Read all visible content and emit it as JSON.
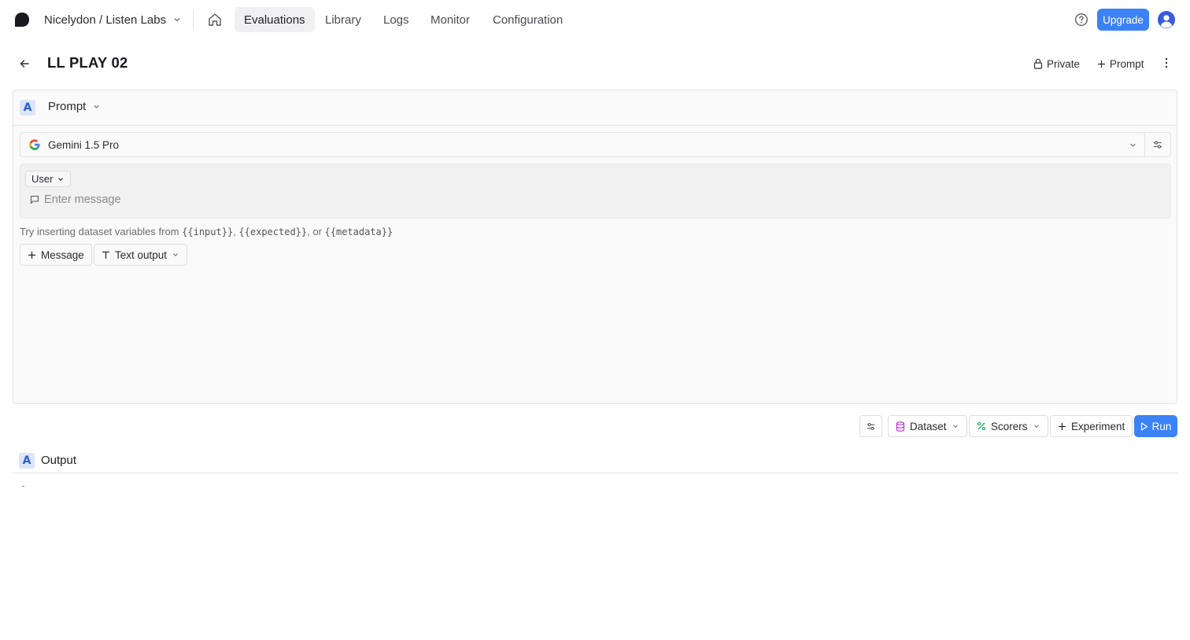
{
  "topbar": {
    "org": "Nicelydon / Listen Labs",
    "nav": [
      {
        "label": "Evaluations",
        "active": true
      },
      {
        "label": "Library",
        "active": false
      },
      {
        "label": "Logs",
        "active": false
      },
      {
        "label": "Monitor",
        "active": false
      },
      {
        "label": "Configuration",
        "active": false
      }
    ],
    "upgrade_label": "Upgrade",
    "accent": "#3b82f6"
  },
  "header": {
    "title": "LL PLAY 02",
    "private_label": "Private",
    "add_prompt_label": "Prompt"
  },
  "prompt_card": {
    "badge": "A",
    "title": "Prompt",
    "model": "Gemini 1.5 Pro",
    "message": {
      "role": "User",
      "placeholder": "Enter message"
    },
    "hint": {
      "prefix": "Try inserting dataset variables from ",
      "var_input": "{{input}}",
      "sep1": ", ",
      "var_expected": "{{expected}}",
      "sep2": ", or ",
      "var_metadata": "{{metadata}}"
    },
    "add_message_label": "Message",
    "output_type_label": "Text output"
  },
  "toolbar": {
    "dataset_label": "Dataset",
    "scorers_label": "Scorers",
    "experiment_label": "Experiment",
    "run_label": "Run"
  },
  "output": {
    "badge": "A",
    "title": "Output",
    "value": "-"
  }
}
